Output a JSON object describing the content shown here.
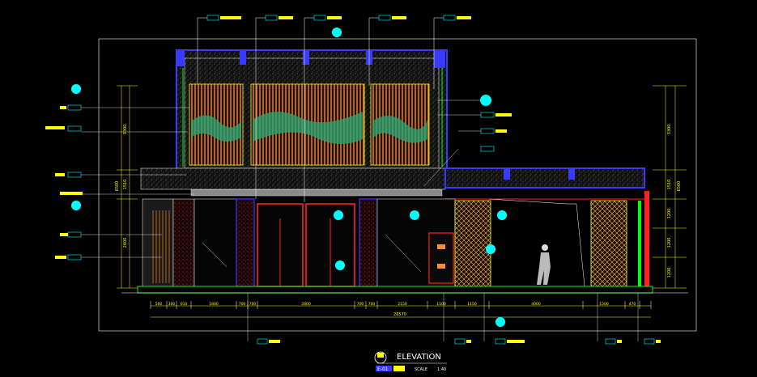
{
  "title": {
    "main": "ELEVATION",
    "id": "E-01",
    "scale_label": "SCALE",
    "scale_value": "1:40"
  },
  "dimensions_bottom": [
    "500",
    "300",
    "610",
    "1800",
    "700",
    "700",
    "2800",
    "700",
    "700",
    "2150",
    "1100",
    "1150",
    "4000",
    "1500",
    "470"
  ],
  "dimensions_total": "26570",
  "dimensions_left": [
    "3300",
    "1510",
    "2600",
    "6500"
  ],
  "dimensions_right": [
    "3300",
    "1510",
    "1200",
    "1200",
    "1200",
    "6500"
  ],
  "colors": {
    "background": "#000000",
    "frame": "#ffffff",
    "cyan": "#00ffff",
    "yellow": "#ffff00",
    "green": "#00ff00",
    "blue": "#3a3aff",
    "red": "#ff2020",
    "orange": "#ff8c2a",
    "magenta": "#ff40ff"
  }
}
